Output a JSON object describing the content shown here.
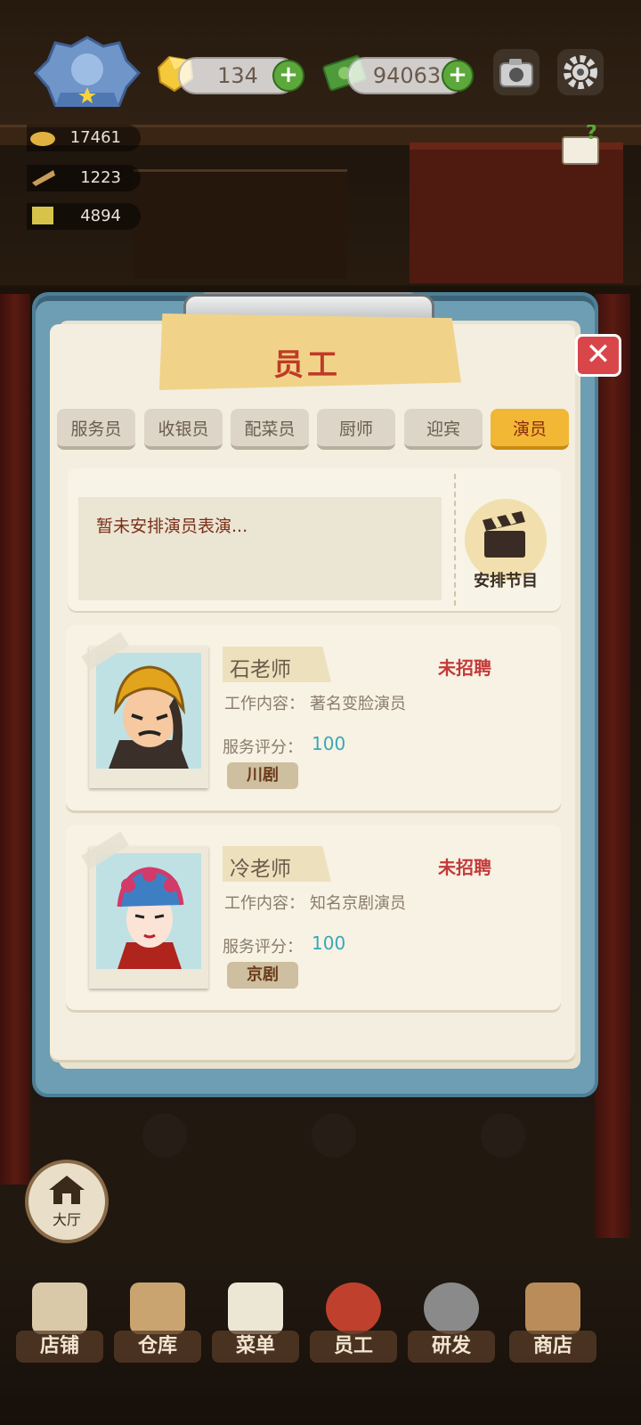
{
  "hud": {
    "gems": "134",
    "cash": "94063",
    "stats": [
      "17461",
      "1223",
      "4894"
    ]
  },
  "dialog": {
    "title": "员工",
    "tabs": [
      "服务员",
      "收银员",
      "配菜员",
      "厨师",
      "迎宾",
      "演员"
    ],
    "active_tab_index": 5,
    "notice": "暂未安排演员表演...",
    "arrange_button": "安排节目"
  },
  "staff": [
    {
      "name": "石老师",
      "status": "未招聘",
      "job_label": "工作内容：",
      "job": "著名变脸演员",
      "score_label": "服务评分：",
      "score": "100",
      "tag": "川剧"
    },
    {
      "name": "冷老师",
      "status": "未招聘",
      "job_label": "工作内容：",
      "job": "知名京剧演员",
      "score_label": "服务评分：",
      "score": "100",
      "tag": "京剧"
    }
  ],
  "side_button": "大厅",
  "nav": [
    "店铺",
    "仓库",
    "菜单",
    "员工",
    "研发",
    "商店"
  ],
  "colors": {
    "accent_tab": "#f2b735",
    "status_red": "#c23a3a",
    "score_teal": "#38a8b8",
    "board_blue": "#6e9eb4"
  }
}
